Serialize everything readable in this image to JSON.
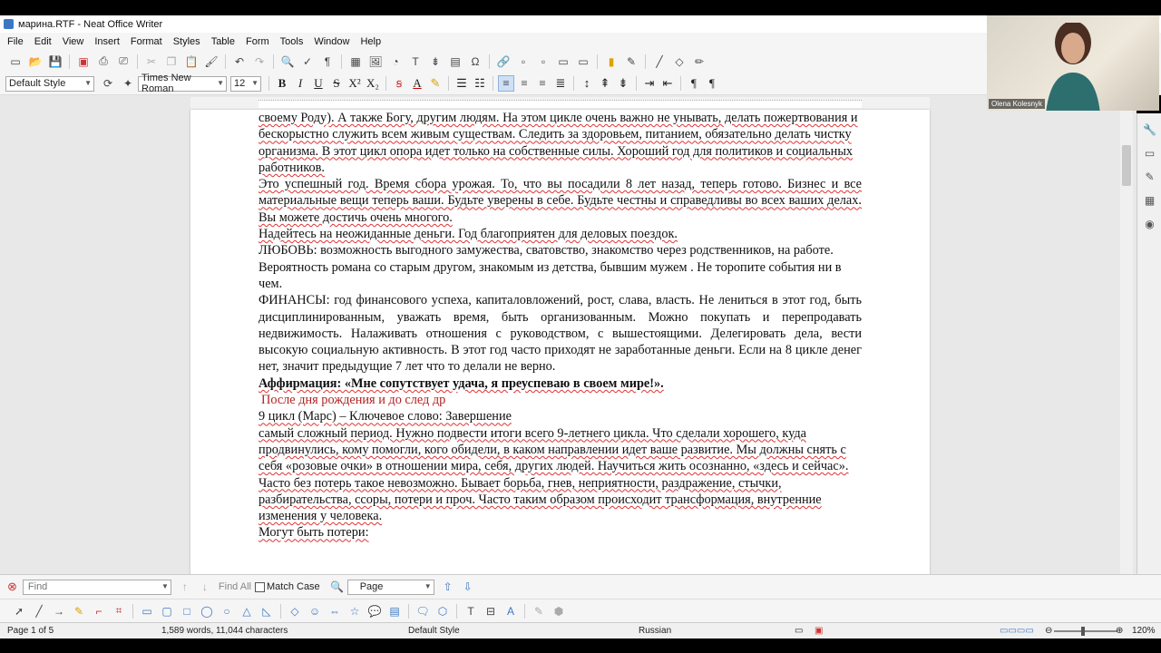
{
  "window": {
    "title": "марина.RTF - Neat Office Writer"
  },
  "menu": [
    "File",
    "Edit",
    "View",
    "Insert",
    "Format",
    "Styles",
    "Table",
    "Form",
    "Tools",
    "Window",
    "Help"
  ],
  "formatting": {
    "paragraph_style": "Default Style",
    "font_name": "Times New Roman",
    "font_size": "12",
    "bold_label": "B",
    "italic_label": "I",
    "underline_label": "U",
    "strike_label": "S"
  },
  "document": {
    "paragraphs": [
      {
        "text": "своему Роду). А также Богу, другим людям. На этом цикле очень важно не унывать, делать пожертвования и бескорыстно служить всем живым существам. Следить за здоровьем, питанием, обязательно делать чистку организма. В этот цикл опора идет только на собственные силы. Хороший год для политиков и социальных работников.",
        "style": "squig"
      },
      {
        "text": "Это успешный год. Время сбора урожая. То, что вы посадили 8 лет назад, теперь готово. Бизнес и все материальные вещи теперь ваши. Будьте уверены в себе. Будьте честны и справедливы во всех ваших делах. Вы можете достичь очень многого.",
        "style": "squig j"
      },
      {
        "text": "Надейтесь на неожиданные деньги. Год благоприятен для деловых поездок.",
        "style": "squig"
      },
      {
        "text": "ЛЮБОВЬ: возможность выгодного замужества, сватовство, знакомство через родственников, на работе. Вероятность романа со старым другом, знакомым из детства, бывшим мужем . Не торопите события ни в чем.",
        "style": ""
      },
      {
        "text": "ФИНАНСЫ: год финансового успеха, капиталовложений, рост, слава, власть.  Не лениться в этот год, быть дисциплинированным, уважать время, быть организованным. Можно покупать и перепродавать недвижимость. Налаживать отношения с руководством,  с вышестоящими. Делегировать дела, вести высокую социальную активность. В этот год часто приходят не заработанные деньги. Если на 8 цикле денег нет, значит предыдущие 7 лет что то делали не верно.",
        "style": "j"
      },
      {
        "text": "Аффирмация: «Мне сопутствует удача, я преуспеваю в своем мире!».",
        "style": "b squig"
      },
      {
        "text": " ",
        "style": ""
      },
      {
        "text": "После дня рождения и до след др",
        "style": "red"
      },
      {
        "text": "9 цикл (Марс) – Ключевое слово: Завершение",
        "style": "squig"
      },
      {
        "text": "самый сложный период. Нужно подвести итоги всего 9-летнего цикла. Что сделали хорошего, куда продвинулись, кому помогли, кого обидели, в каком направлении идет ваше развитие. Мы должны снять с себя «розовые очки» в отношении мира, себя, других людей. Научиться жить осознанно, «здесь и сейчас». Часто без потерь такое невозможно. Бывает борьба, гнев, неприятности, раздражение, стычки, разбирательства, ссоры, потери и проч. Часто таким образом происходит трансформация, внутренние изменения у человека.",
        "style": "squig"
      },
      {
        "text": "Могут быть потери:",
        "style": "squig"
      }
    ]
  },
  "webcam": {
    "name": "Olena Kolesnyk"
  },
  "findbar": {
    "placeholder": "Find",
    "find_all": "Find All",
    "match_case": "Match Case",
    "search_scope": "Page"
  },
  "status": {
    "page": "Page 1 of 5",
    "words": "1,589 words, 11,044 characters",
    "style": "Default Style",
    "language": "Russian",
    "zoom": "120%"
  }
}
